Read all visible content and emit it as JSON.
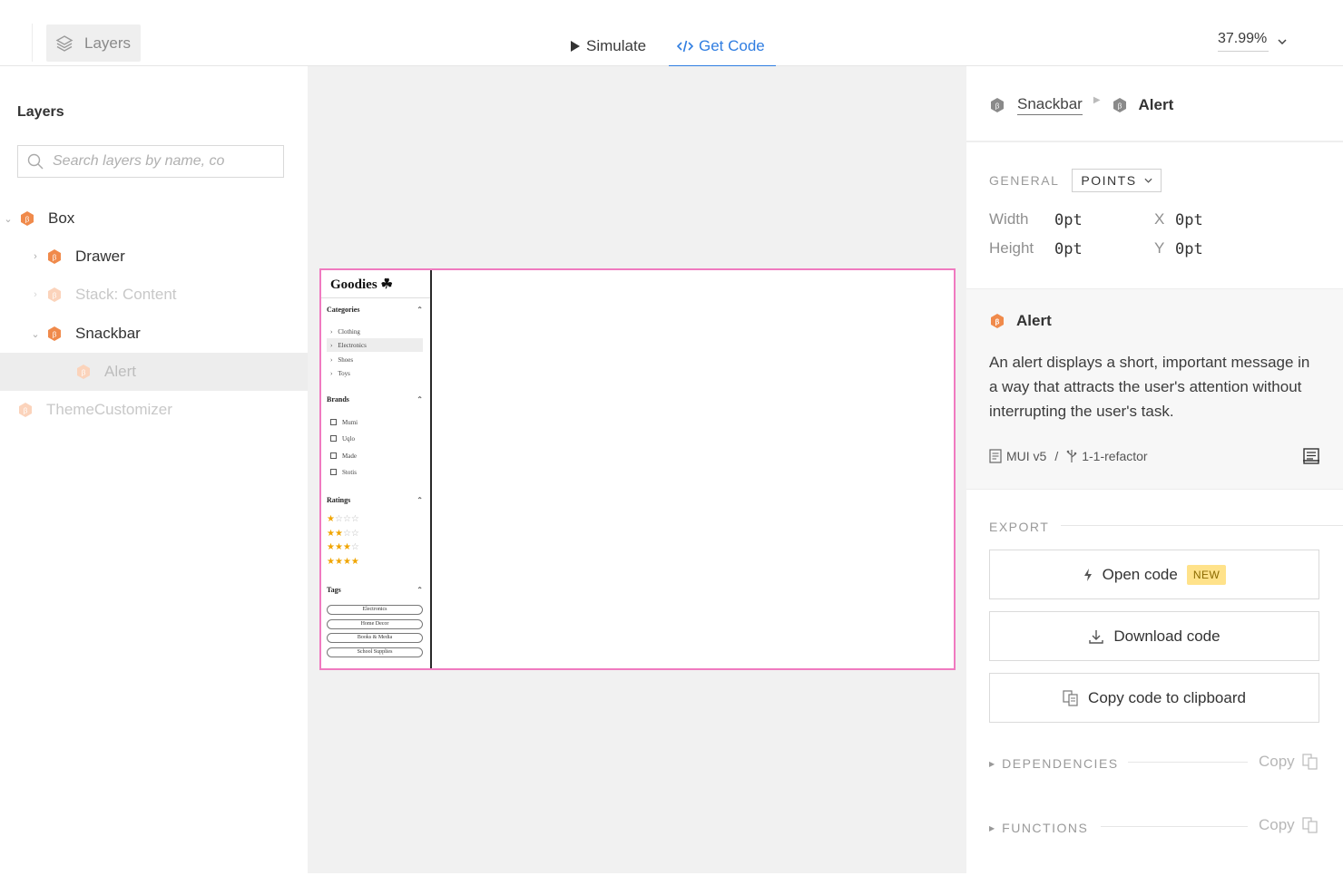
{
  "topbar": {
    "layers_toggle_label": "Layers",
    "tabs": [
      {
        "label": "Simulate",
        "active": false
      },
      {
        "label": "Get Code",
        "active": true
      }
    ],
    "zoom": "37.99%"
  },
  "left": {
    "title": "Layers",
    "search_placeholder": "Search layers by name, co",
    "tree": [
      {
        "label": "Box",
        "expanded": true,
        "faded": false
      },
      {
        "label": "Drawer",
        "expanded": false,
        "faded": false
      },
      {
        "label": "Stack: Content",
        "expanded": false,
        "faded": true
      },
      {
        "label": "Snackbar",
        "expanded": true,
        "faded": false
      },
      {
        "label": "Alert",
        "selected": true
      },
      {
        "label": "ThemeCustomizer",
        "faded": true
      }
    ]
  },
  "canvas": {
    "brand": "Goodies",
    "sections": {
      "categories": {
        "title": "Categories",
        "items": [
          "Clothing",
          "Electronics",
          "Shoes",
          "Toys"
        ],
        "selected": "Electronics"
      },
      "brands": {
        "title": "Brands",
        "items": [
          "Mumi",
          "Uqlo",
          "Made",
          "Stotis"
        ]
      },
      "ratings": {
        "title": "Ratings",
        "levels": [
          1,
          2,
          3,
          4
        ],
        "max": 4
      },
      "tags": {
        "title": "Tags",
        "items": [
          "Electronics",
          "Home Decor",
          "Books & Media",
          "School Supplies"
        ]
      }
    }
  },
  "right": {
    "breadcrumb": {
      "parent": "Snackbar",
      "current": "Alert"
    },
    "general_label": "GENERAL",
    "units": "POINTS",
    "dimensions": {
      "width_label": "Width",
      "width": "0pt",
      "height_label": "Height",
      "height": "0pt",
      "x_label": "X",
      "x": "0pt",
      "y_label": "Y",
      "y": "0pt"
    },
    "component": {
      "name": "Alert",
      "description": "An alert displays a short, important message in a way that attracts the user's attention without interrupting the user's task.",
      "library": "MUI v5",
      "separator": "/",
      "branch": "1-1-refactor"
    },
    "export_label": "EXPORT",
    "buttons": {
      "open_code": "Open code",
      "open_code_badge": "NEW",
      "download_code": "Download code",
      "copy_clipboard": "Copy code to clipboard"
    },
    "dependencies_label": "DEPENDENCIES",
    "functions_label": "FUNCTIONS",
    "copy_label": "Copy"
  },
  "colors": {
    "accent": "#2f7de1",
    "component_orange": "#f08a4b",
    "frame_pink": "#f07ac0",
    "badge_yellow": "#ffe28a"
  }
}
